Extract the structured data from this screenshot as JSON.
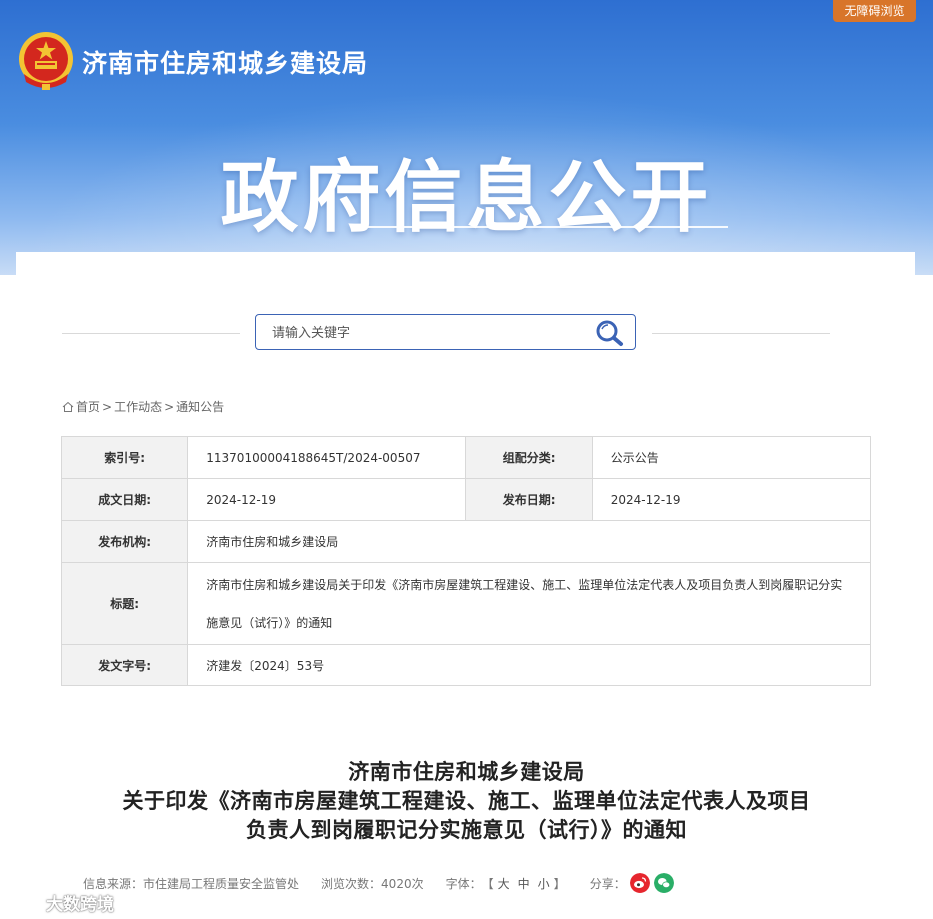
{
  "header": {
    "accessibility_label": "无障碍浏览",
    "site_name": "济南市住房和城乡建设局",
    "banner_title": "政府信息公开"
  },
  "search": {
    "placeholder": "请输入关键字"
  },
  "breadcrumb": {
    "items": [
      "首页",
      "工作动态",
      "通知公告"
    ],
    "separator": ">"
  },
  "info": {
    "index_label": "索引号:",
    "index_value": "11370100004188645T/2024-00507",
    "category_label": "组配分类:",
    "category_value": "公示公告",
    "date_written_label": "成文日期:",
    "date_written_value": "2024-12-19",
    "publish_date_label": "发布日期:",
    "publish_date_value": "2024-12-19",
    "issuer_label": "发布机构:",
    "issuer_value": "济南市住房和城乡建设局",
    "title_label": "标题:",
    "title_value": "济南市住房和城乡建设局关于印发《济南市房屋建筑工程建设、施工、监理单位法定代表人及项目负责人到岗履职记分实施意见（试行）》的通知",
    "doc_number_label": "发文字号:",
    "doc_number_value": "济建发〔2024〕53号"
  },
  "article": {
    "title_line1": "济南市住房和城乡建设局",
    "title_line2": "关于印发《济南市房屋建筑工程建设、施工、监理单位法定代表人及项目",
    "title_line3": "负责人到岗履职记分实施意见（试行）》的通知"
  },
  "meta": {
    "source_label": "信息来源：",
    "source_value": "市住建局工程质量安全监管处",
    "views_label": "浏览次数：",
    "views_value": "4020次",
    "font_label": "字体：",
    "font_open": "【",
    "font_large": "大",
    "font_medium": "中",
    "font_small": "小",
    "font_close": "】",
    "share_label": "分享："
  },
  "watermark": {
    "text": "大数跨境"
  },
  "colors": {
    "banner_top": "#2e6fd1",
    "search_border": "#3b63b5",
    "a11y_button": "#d8752a",
    "weibo": "#e6262e",
    "wechat": "#2aae67"
  }
}
